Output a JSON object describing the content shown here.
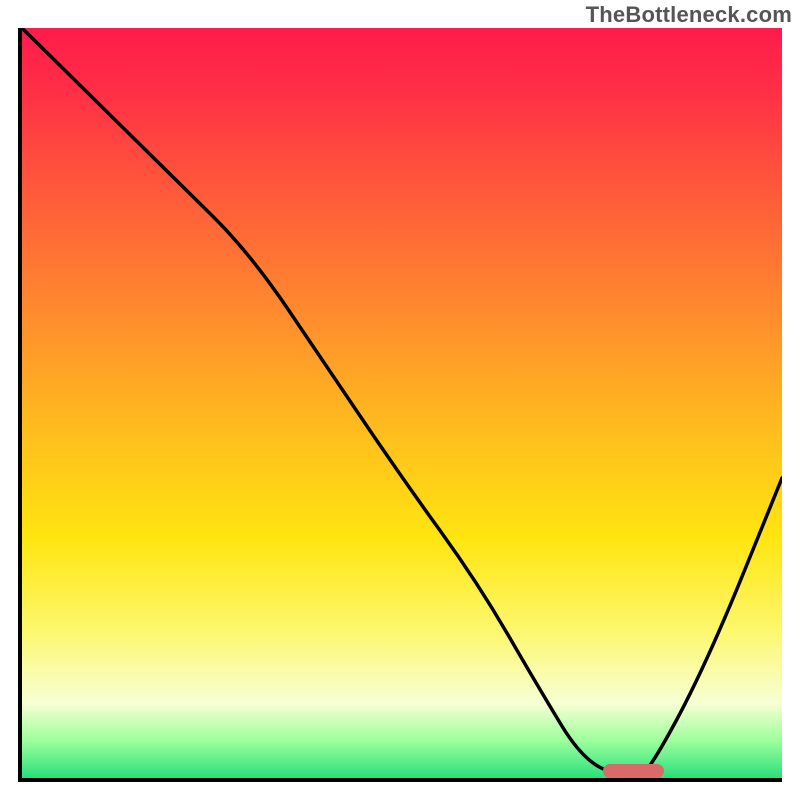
{
  "watermark": "TheBottleneck.com",
  "chart_data": {
    "type": "line",
    "title": "",
    "xlabel": "",
    "ylabel": "",
    "xlim": [
      0,
      100
    ],
    "ylim": [
      0,
      100
    ],
    "grid": false,
    "legend": false,
    "background_gradient": {
      "direction": "vertical",
      "stops": [
        {
          "pos": 0,
          "color": "#ff1b4b"
        },
        {
          "pos": 22,
          "color": "#ff5a3a"
        },
        {
          "pos": 52,
          "color": "#ffb81f"
        },
        {
          "pos": 80,
          "color": "#fdf76a"
        },
        {
          "pos": 95,
          "color": "#9cff9c"
        },
        {
          "pos": 100,
          "color": "#28e07a"
        }
      ]
    },
    "series": [
      {
        "name": "bottleneck-curve",
        "x": [
          0,
          10,
          20,
          30,
          40,
          50,
          60,
          68,
          74,
          80,
          82,
          90,
          100
        ],
        "y": [
          100,
          90,
          80,
          70,
          55,
          40,
          26,
          12,
          2,
          0,
          0,
          15,
          40
        ],
        "color": "#000000",
        "stroke_width": 3
      }
    ],
    "annotations": [
      {
        "name": "optimal-marker",
        "shape": "pill",
        "x_range": [
          76,
          84
        ],
        "y": 1,
        "color": "#d86a6a"
      }
    ]
  }
}
